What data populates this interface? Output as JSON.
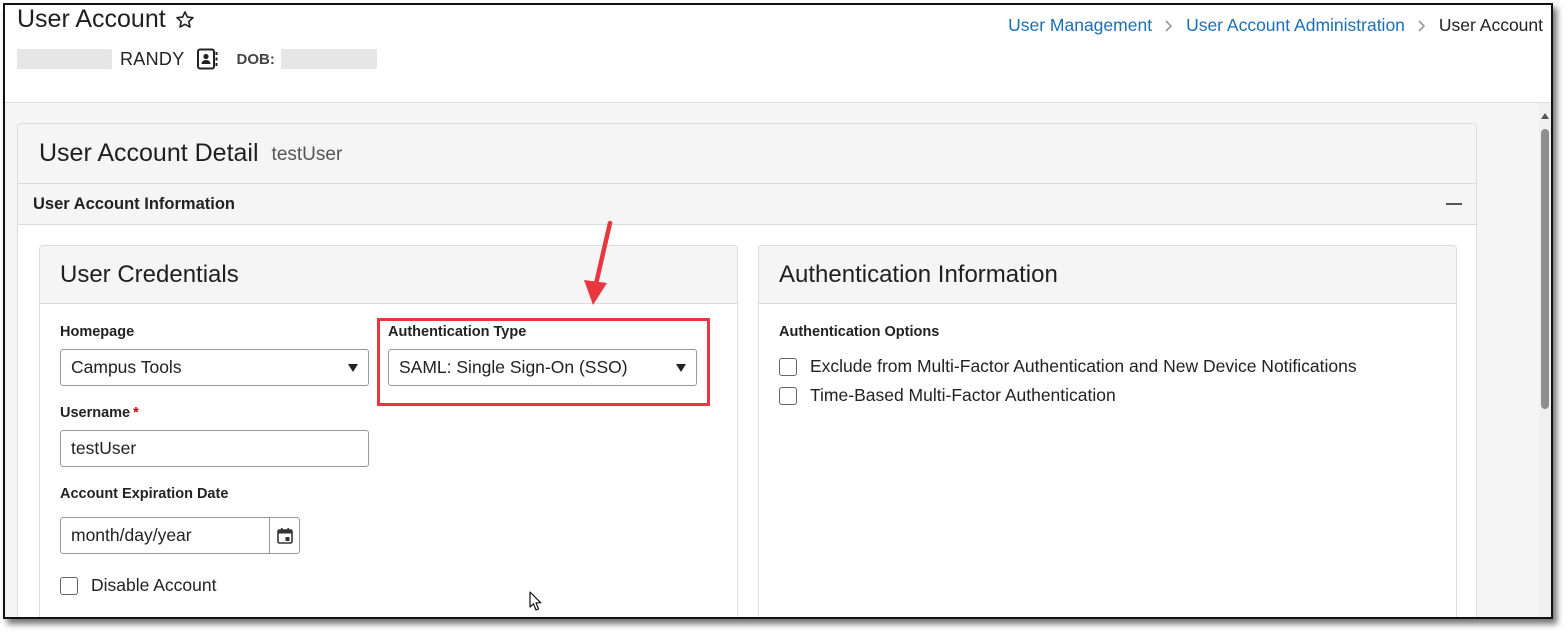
{
  "header": {
    "title": "User Account",
    "person": {
      "first_name": "RANDY",
      "dob_label": "DOB:"
    },
    "breadcrumb": [
      "User Management",
      "User Account Administration",
      "User Account"
    ]
  },
  "card": {
    "title": "User Account Detail",
    "subtitle": "testUser",
    "section_title": "User Account Information"
  },
  "credentials": {
    "panel_title": "User Credentials",
    "homepage_label": "Homepage",
    "homepage_value": "Campus Tools",
    "auth_type_label": "Authentication Type",
    "auth_type_value": "SAML: Single Sign-On (SSO)",
    "username_label": "Username",
    "username_required": "*",
    "username_value": "testUser",
    "expiration_label": "Account Expiration Date",
    "expiration_placeholder": "month/day/year",
    "disable_label": "Disable Account"
  },
  "auth_info": {
    "panel_title": "Authentication Information",
    "options_label": "Authentication Options",
    "options": [
      "Exclude from Multi-Factor Authentication and New Device Notifications",
      "Time-Based Multi-Factor Authentication"
    ]
  },
  "colors": {
    "link": "#1a6fb5",
    "highlight": "#e8373f",
    "required": "#cc0000"
  },
  "icons": [
    "star-icon",
    "contact-card-icon",
    "chevron-right-icon",
    "calendar-icon",
    "collapse-icon",
    "mouse-cursor-icon"
  ]
}
